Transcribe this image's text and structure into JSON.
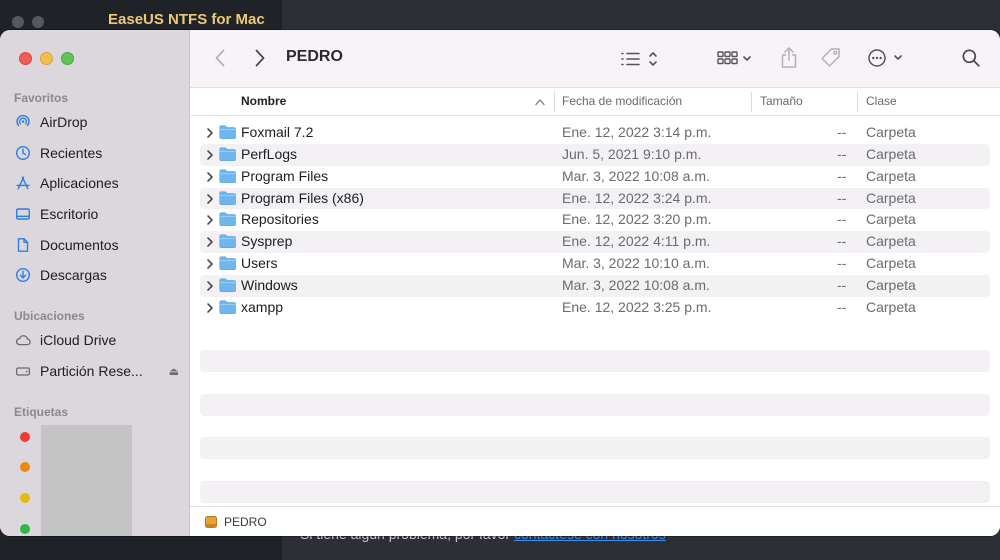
{
  "background_app": {
    "title": "EaseUS NTFS for Mac",
    "footer_text": "Si tiene algún problema, por favor",
    "footer_link": "contáctese con nosotros"
  },
  "toolbar": {
    "back_icon": "chevron-left-icon",
    "forward_icon": "chevron-right-icon",
    "title": "PEDRO"
  },
  "sidebar": {
    "favorites_label": "Favoritos",
    "favorites": [
      {
        "label": "AirDrop",
        "icon": "airdrop-icon"
      },
      {
        "label": "Recientes",
        "icon": "clock-icon"
      },
      {
        "label": "Aplicaciones",
        "icon": "applications-icon"
      },
      {
        "label": "Escritorio",
        "icon": "desktop-icon"
      },
      {
        "label": "Documentos",
        "icon": "document-icon"
      },
      {
        "label": "Descargas",
        "icon": "download-icon"
      }
    ],
    "locations_label": "Ubicaciones",
    "locations": [
      {
        "label": "iCloud Drive",
        "icon": "cloud-icon"
      },
      {
        "label": "Partición Rese...",
        "icon": "drive-icon"
      }
    ],
    "tags_label": "Etiquetas",
    "tags": [
      {
        "color": "#ee3b33"
      },
      {
        "color": "#f0870f"
      },
      {
        "color": "#e8b80e"
      },
      {
        "color": "#2fb845"
      }
    ]
  },
  "columns": {
    "name": "Nombre",
    "modified": "Fecha de modificación",
    "size": "Tamaño",
    "kind": "Clase"
  },
  "files": [
    {
      "name": "Foxmail 7.2",
      "date": "Ene. 12, 2022 3:14 p.m.",
      "size": "--",
      "kind": "Carpeta"
    },
    {
      "name": "PerfLogs",
      "date": "Jun. 5, 2021 9:10 p.m.",
      "size": "--",
      "kind": "Carpeta"
    },
    {
      "name": "Program Files",
      "date": "Mar. 3, 2022 10:08 a.m.",
      "size": "--",
      "kind": "Carpeta"
    },
    {
      "name": "Program Files (x86)",
      "date": "Ene. 12, 2022 3:24 p.m.",
      "size": "--",
      "kind": "Carpeta"
    },
    {
      "name": "Repositories",
      "date": "Ene. 12, 2022 3:20 p.m.",
      "size": "--",
      "kind": "Carpeta"
    },
    {
      "name": "Sysprep",
      "date": "Ene. 12, 2022 4:11 p.m.",
      "size": "--",
      "kind": "Carpeta"
    },
    {
      "name": "Users",
      "date": "Mar. 3, 2022 10:10 a.m.",
      "size": "--",
      "kind": "Carpeta"
    },
    {
      "name": "Windows",
      "date": "Mar. 3, 2022 10:08 a.m.",
      "size": "--",
      "kind": "Carpeta"
    },
    {
      "name": "xampp",
      "date": "Ene. 12, 2022 3:25 p.m.",
      "size": "--",
      "kind": "Carpeta"
    }
  ],
  "pathbar": {
    "label": "PEDRO"
  },
  "colors": {
    "folder": "#6fb6ee",
    "sidebar_icon": "#2f7fe0",
    "accent_title": "#f0c877"
  }
}
